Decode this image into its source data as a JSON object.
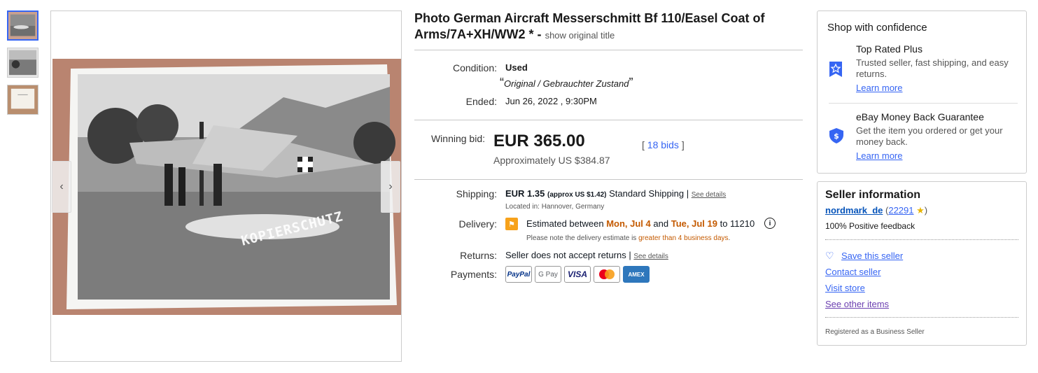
{
  "title": {
    "main": "Photo German Aircraft Messerschmitt Bf 110/Easel Coat of Arms/7A+XH/WW2 * -",
    "show_original": "show original title"
  },
  "gallery": {
    "watermark": "KOPIERSCHUTZ",
    "prev_icon": "‹",
    "next_icon": "›"
  },
  "details": {
    "condition_label": "Condition:",
    "condition_value": "Used",
    "condition_quote": "Original / Gebrauchter Zustand",
    "ended_label": "Ended:",
    "ended_value": "Jun 26, 2022 , 9:30PM"
  },
  "bid": {
    "label": "Winning bid:",
    "price": "EUR 365.00",
    "approx_prefix": "Approximately",
    "approx_value": "US $384.87",
    "bids_open": "[",
    "bids_link": "18 bids",
    "bids_close": "]"
  },
  "shipping": {
    "label": "Shipping:",
    "cost": "EUR 1.35",
    "approx": "(approx US $1.42)",
    "method": "Standard Shipping",
    "sep": "|",
    "see_details": "See details",
    "located": "Located in: Hannover, Germany"
  },
  "delivery": {
    "label": "Delivery:",
    "prefix": "Estimated between",
    "date1": "Mon, Jul 4",
    "and": "and",
    "date2": "Tue, Jul 19",
    "suffix": "to 11210",
    "note_prefix": "Please note the delivery estimate is",
    "note_highlight": "greater than 4 business days",
    "note_end": "."
  },
  "returns": {
    "label": "Returns:",
    "value": "Seller does not accept returns",
    "sep": "|",
    "see_details": "See details"
  },
  "payments": {
    "label": "Payments:",
    "methods": [
      "PayPal",
      "G Pay",
      "VISA",
      "Mastercard",
      "AMEX"
    ]
  },
  "confidence": {
    "title": "Shop with confidence",
    "items": [
      {
        "title": "Top Rated Plus",
        "text": "Trusted seller, fast shipping, and easy returns.",
        "link": "Learn more"
      },
      {
        "title": "eBay Money Back Guarantee",
        "text": "Get the item you ordered or get your money back.",
        "link": "Learn more"
      }
    ]
  },
  "seller": {
    "title": "Seller information",
    "name": "nordmark_de",
    "score": "22291",
    "feedback": "100% Positive feedback",
    "save": "Save this seller",
    "contact": "Contact seller",
    "visit": "Visit store",
    "other": "See other items",
    "registered": "Registered as a Business Seller"
  },
  "colors": {
    "link": "#3665f3",
    "delivery_highlight": "#c45a00",
    "badge_blue": "#3665f3"
  }
}
